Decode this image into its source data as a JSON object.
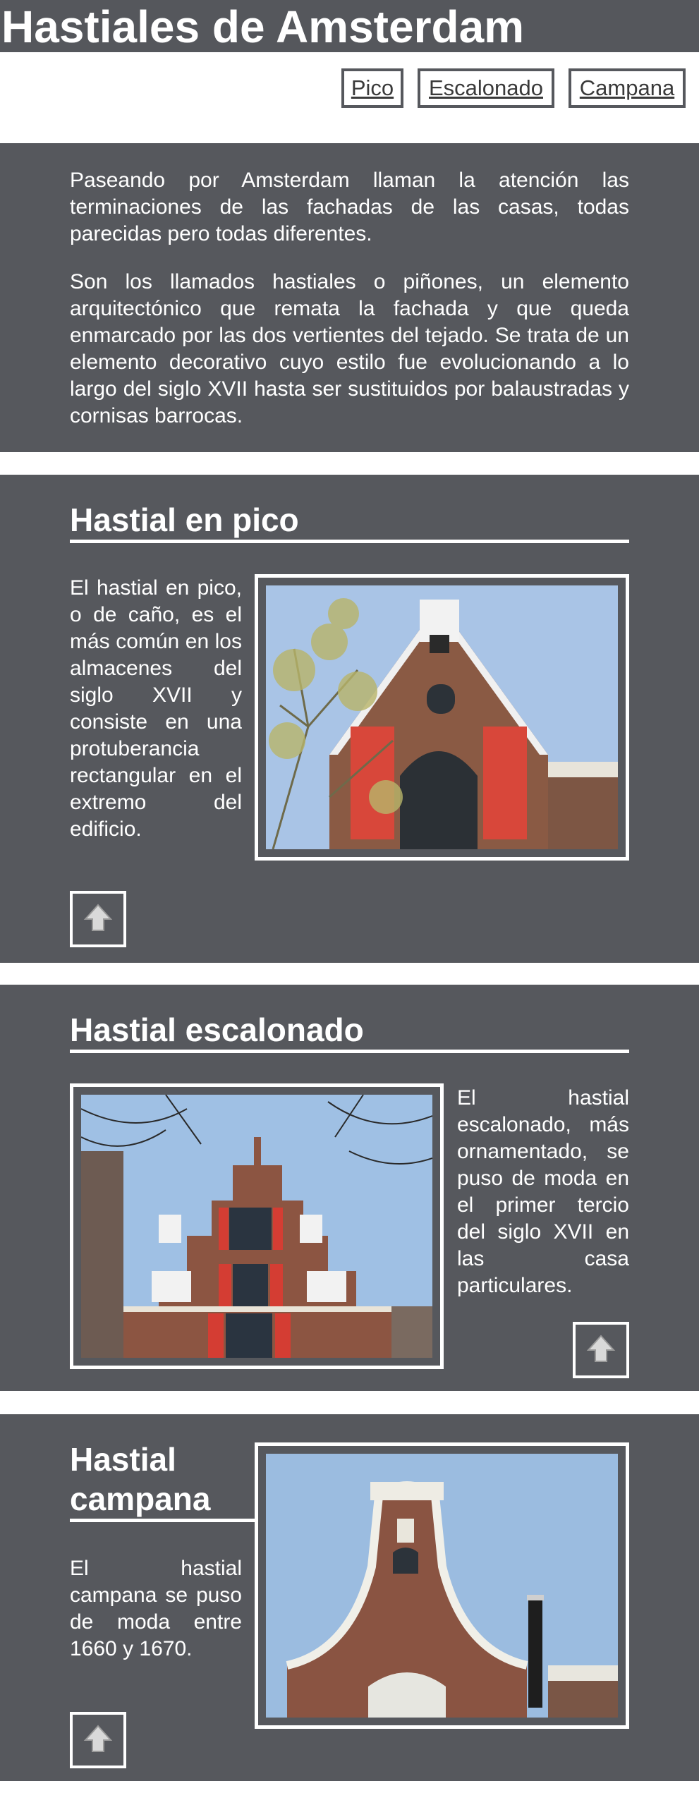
{
  "header": {
    "title": "Hastiales de Amsterdam"
  },
  "nav": {
    "items": [
      "Pico",
      "Escalonado",
      "Campana"
    ]
  },
  "intro": {
    "paragraphs": [
      "Paseando por Amsterdam llaman la atención las terminaciones de las fachadas de las casas, todas parecidas pero todas diferentes.",
      "Son los llamados hastiales o piñones, un elemento arquitectónico que remata la fachada y que queda enmarcado por las dos vertientes del tejado. Se trata de un elemento decorativo cuyo estilo fue evolucionando a lo largo del siglo XVII hasta ser sustituidos por balaustradas y cornisas barrocas."
    ]
  },
  "sections": [
    {
      "title": "Hastial en pico",
      "text": "El hastial en pico, o de caño, es el más común en los almacenes del siglo XVII y consiste en una protuberancia rectangular en el extremo del edificio.",
      "image_subject": "pointed-gable-house-photo"
    },
    {
      "title": "Hastial escalonado",
      "text": "El hastial escalonado, más ornamentado, se puso de moda en el primer tercio del siglo XVII en las casa particulares.",
      "image_subject": "stepped-gable-house-photo"
    },
    {
      "title": "Hastial campana",
      "text": "El hastial campana se puso de moda entre 1660 y 1670.",
      "image_subject": "bell-gable-house-photo"
    }
  ],
  "icons": {
    "back_to_top": "up-arrow-icon"
  },
  "colors": {
    "panel": "#56585d",
    "page": "#ffffff",
    "text": "#ffffff",
    "nav_text": "#3a3a3a"
  }
}
